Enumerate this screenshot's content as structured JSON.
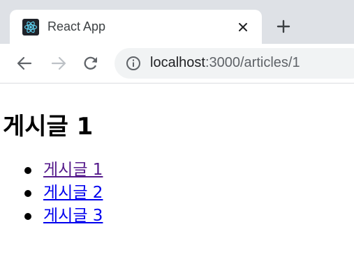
{
  "browser": {
    "tab_title": "React App",
    "favicon_icon": "react-logo-icon",
    "new_tab_icon": "plus-icon",
    "close_icon": "close-icon"
  },
  "toolbar": {
    "back_icon": "arrow-left-icon",
    "forward_icon": "arrow-right-icon",
    "reload_icon": "reload-icon",
    "site_info_icon": "info-circle-icon",
    "url_host": "localhost",
    "url_rest": ":3000/articles/1"
  },
  "page": {
    "heading": "게시글 1",
    "articles": [
      {
        "label": "게시글 1",
        "visited": true
      },
      {
        "label": "게시글 2",
        "visited": false
      },
      {
        "label": "게시글 3",
        "visited": false
      }
    ]
  },
  "colors": {
    "tabstrip_bg": "#dee1e6",
    "omnibox_bg": "#f1f3f4",
    "link": "#0000ee",
    "link_visited": "#551a8b",
    "react_logo": "#61dafb"
  }
}
